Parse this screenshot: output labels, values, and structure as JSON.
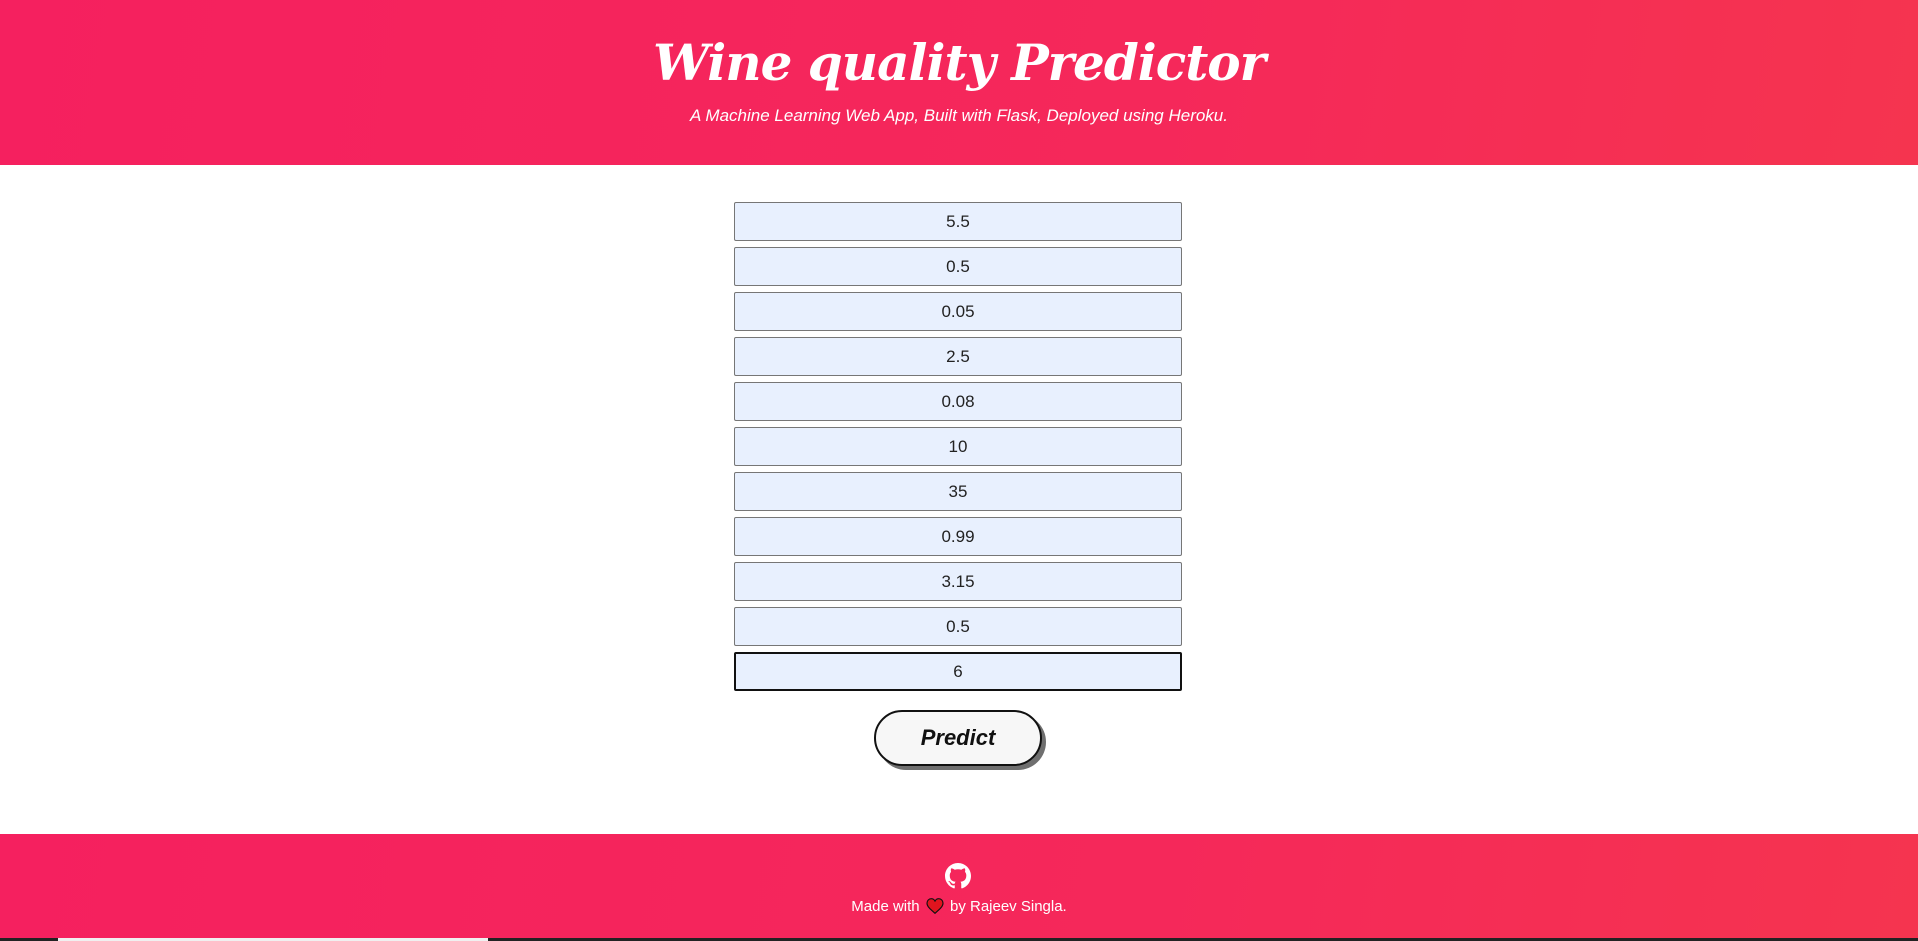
{
  "header": {
    "title": "Wine quality Predictor",
    "subtitle": "A Machine Learning Web App, Built with Flask, Deployed using Heroku."
  },
  "form": {
    "fields": [
      {
        "value": "5.5"
      },
      {
        "value": "0.5"
      },
      {
        "value": "0.05"
      },
      {
        "value": "2.5"
      },
      {
        "value": "0.08"
      },
      {
        "value": "10"
      },
      {
        "value": "35"
      },
      {
        "value": "0.99"
      },
      {
        "value": "3.15"
      },
      {
        "value": "0.5"
      },
      {
        "value": "6"
      }
    ],
    "submit_label": "Predict"
  },
  "footer": {
    "made_with": "Made with",
    "by": "by Rajeev Singla."
  },
  "colors": {
    "brand": "#f5285a",
    "field_bg": "#e8f0fe",
    "heart": "#e0141e"
  },
  "icons": {
    "github": "github-icon",
    "heart": "heart-icon"
  }
}
